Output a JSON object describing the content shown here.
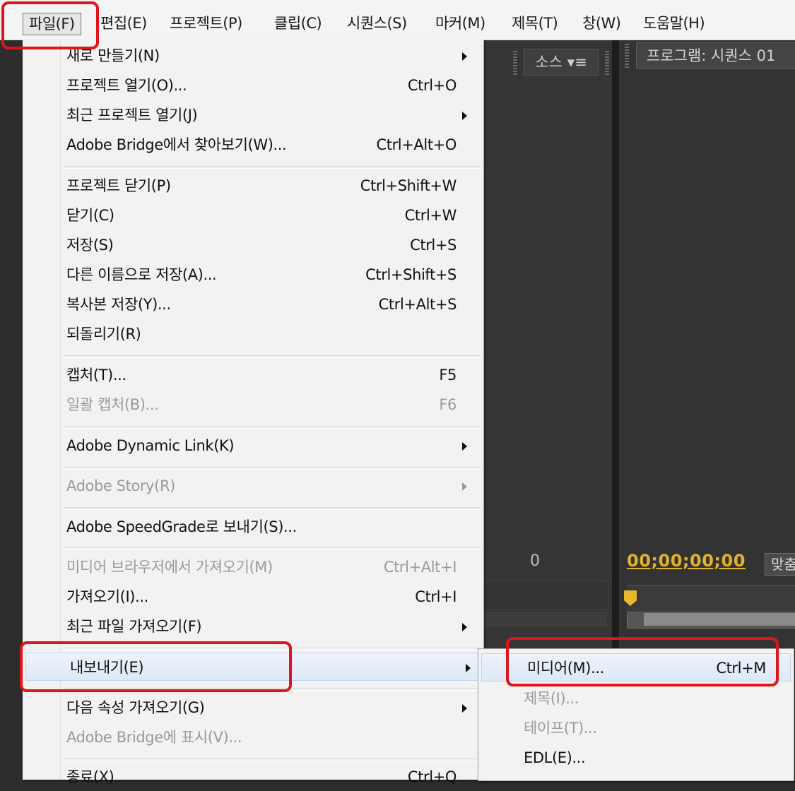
{
  "menubar": {
    "items": [
      {
        "label": "파일(F)"
      },
      {
        "label": "편집(E)"
      },
      {
        "label": "프로젝트(P)"
      },
      {
        "label": "클립(C)"
      },
      {
        "label": "시퀀스(S)"
      },
      {
        "label": "마커(M)"
      },
      {
        "label": "제목(T)"
      },
      {
        "label": "창(W)"
      },
      {
        "label": "도움말(H)"
      }
    ]
  },
  "background": {
    "source_tab": "소스 ▾≡",
    "program_tab": "프로그램: 시퀀스 01",
    "zero_label": "0",
    "timecode": "00;00;00;00",
    "fit_button": "맞춤"
  },
  "file_menu": {
    "items": [
      {
        "label": "새로 만들기(N)",
        "shortcut": "",
        "submenu": true,
        "enabled": true
      },
      {
        "label": "프로젝트 열기(O)...",
        "shortcut": "Ctrl+O",
        "submenu": false,
        "enabled": true
      },
      {
        "label": "최근 프로젝트 열기(J)",
        "shortcut": "",
        "submenu": true,
        "enabled": true
      },
      {
        "label": "Adobe Bridge에서 찾아보기(W)...",
        "shortcut": "Ctrl+Alt+O",
        "submenu": false,
        "enabled": true
      },
      {
        "label": "프로젝트 닫기(P)",
        "shortcut": "Ctrl+Shift+W",
        "submenu": false,
        "enabled": true
      },
      {
        "label": "닫기(C)",
        "shortcut": "Ctrl+W",
        "submenu": false,
        "enabled": true
      },
      {
        "label": "저장(S)",
        "shortcut": "Ctrl+S",
        "submenu": false,
        "enabled": true
      },
      {
        "label": "다른 이름으로 저장(A)...",
        "shortcut": "Ctrl+Shift+S",
        "submenu": false,
        "enabled": true
      },
      {
        "label": "복사본 저장(Y)...",
        "shortcut": "Ctrl+Alt+S",
        "submenu": false,
        "enabled": true
      },
      {
        "label": "되돌리기(R)",
        "shortcut": "",
        "submenu": false,
        "enabled": true
      },
      {
        "label": "캡처(T)...",
        "shortcut": "F5",
        "submenu": false,
        "enabled": true
      },
      {
        "label": "일괄 캡처(B)...",
        "shortcut": "F6",
        "submenu": false,
        "enabled": false
      },
      {
        "label": "Adobe Dynamic Link(K)",
        "shortcut": "",
        "submenu": true,
        "enabled": true
      },
      {
        "label": "Adobe Story(R)",
        "shortcut": "",
        "submenu": true,
        "enabled": false
      },
      {
        "label": "Adobe SpeedGrade로 보내기(S)...",
        "shortcut": "",
        "submenu": false,
        "enabled": true
      },
      {
        "label": "미디어 브라우저에서 가져오기(M)",
        "shortcut": "Ctrl+Alt+I",
        "submenu": false,
        "enabled": false
      },
      {
        "label": "가져오기(I)...",
        "shortcut": "Ctrl+I",
        "submenu": false,
        "enabled": true
      },
      {
        "label": "최근 파일 가져오기(F)",
        "shortcut": "",
        "submenu": true,
        "enabled": true
      },
      {
        "label": "내보내기(E)",
        "shortcut": "",
        "submenu": true,
        "enabled": true
      },
      {
        "label": "다음 속성 가져오기(G)",
        "shortcut": "",
        "submenu": true,
        "enabled": true
      },
      {
        "label": "Adobe Bridge에 표시(V)...",
        "shortcut": "",
        "submenu": false,
        "enabled": false
      },
      {
        "label": "종료(X)",
        "shortcut": "Ctrl+Q",
        "submenu": false,
        "enabled": true
      }
    ]
  },
  "export_submenu": {
    "items": [
      {
        "label": "미디어(M)...",
        "shortcut": "Ctrl+M",
        "enabled": true
      },
      {
        "label": "제목(I)...",
        "shortcut": "",
        "enabled": false
      },
      {
        "label": "테이프(T)...",
        "shortcut": "",
        "enabled": false
      },
      {
        "label": "EDL(E)...",
        "shortcut": "",
        "enabled": true
      }
    ]
  },
  "colors": {
    "annotation": "#e0141b",
    "timecode": "#e2b32a",
    "menu_bg": "#f2f2f2",
    "app_bg": "#2d2d2d"
  }
}
